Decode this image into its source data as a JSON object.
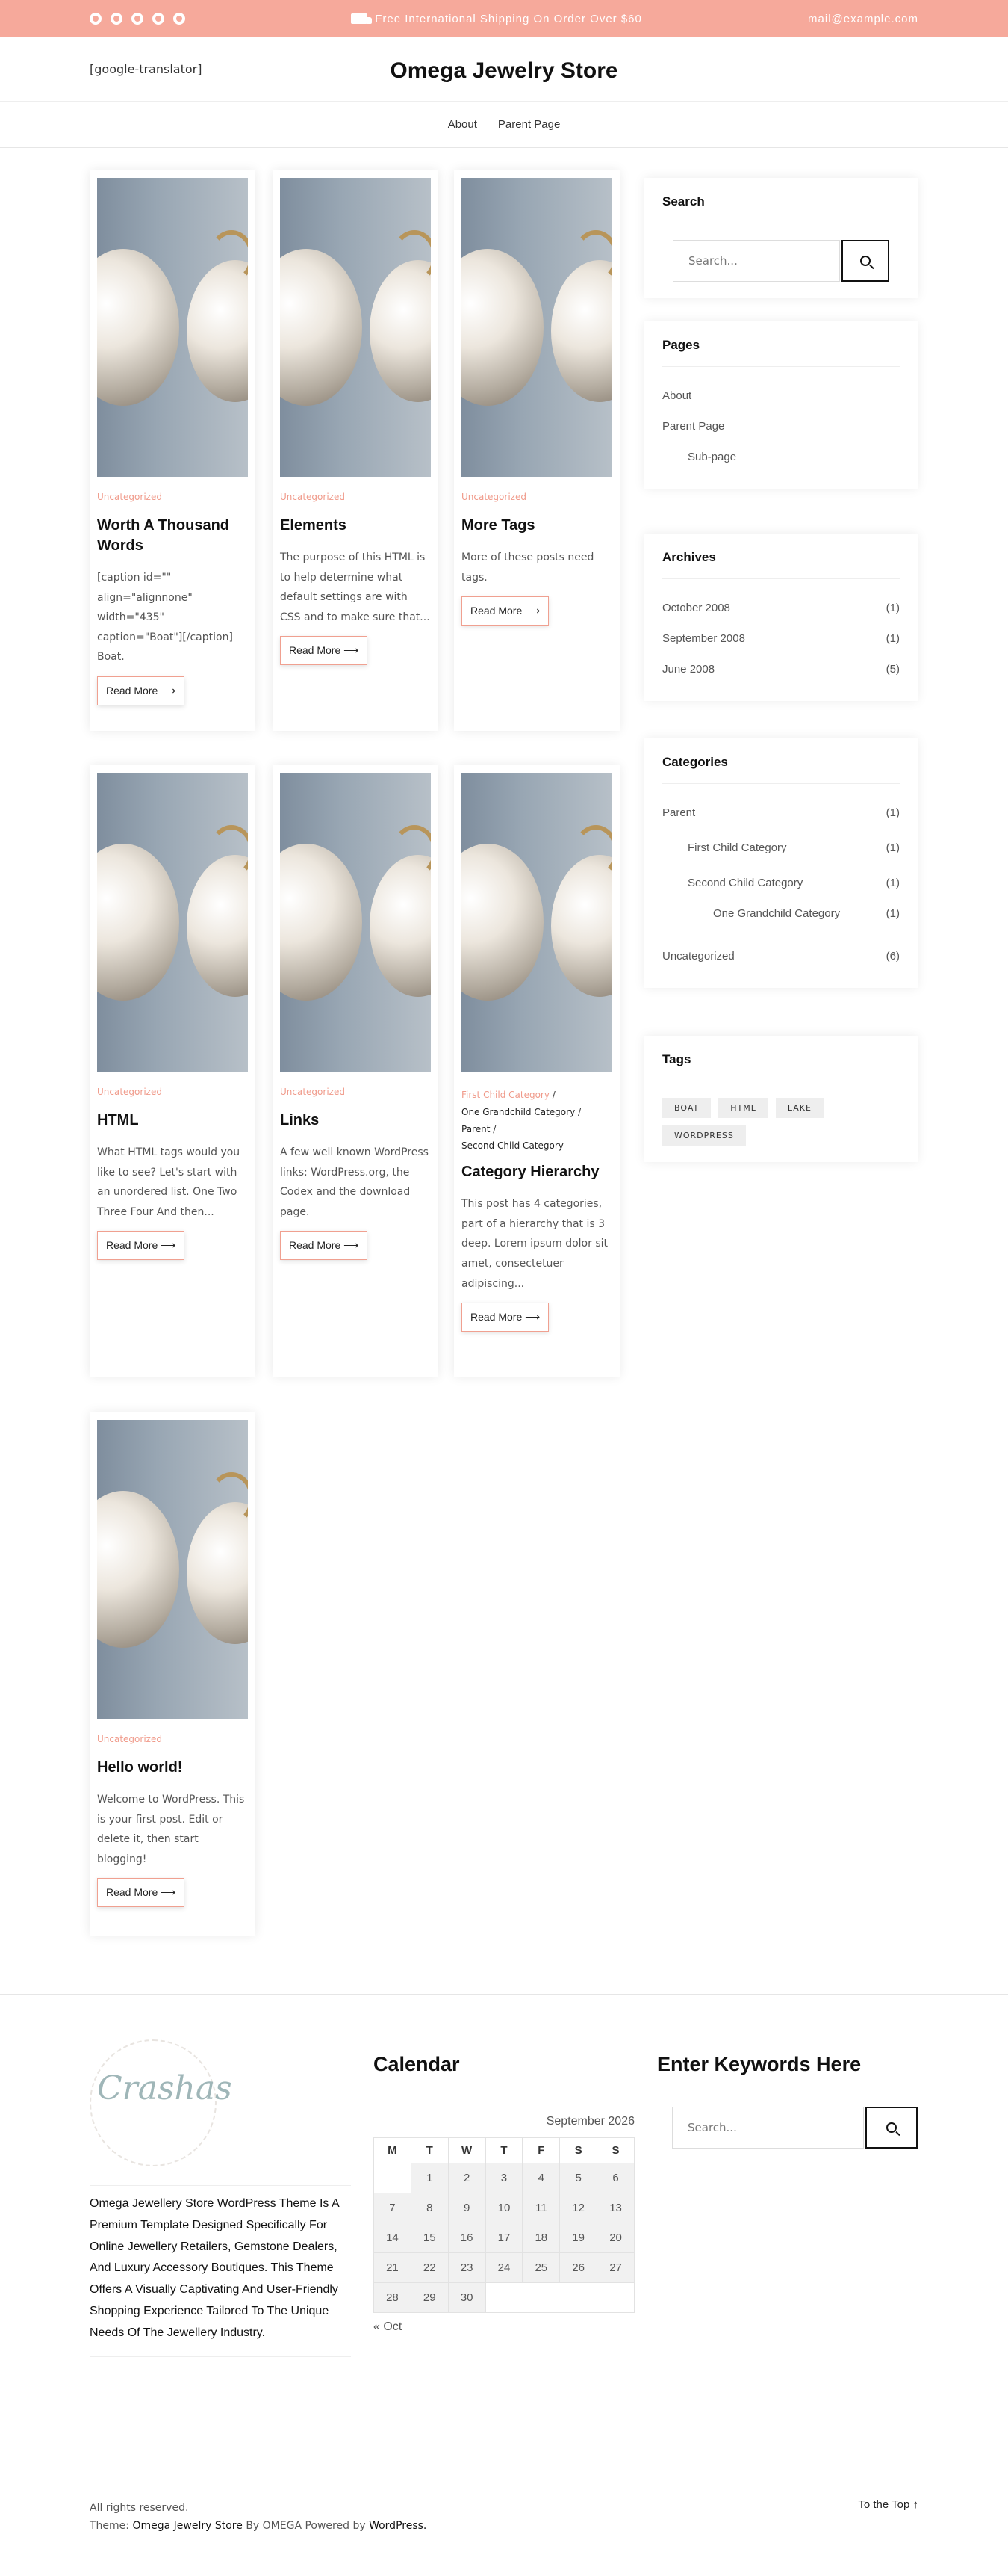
{
  "topbar": {
    "social_icons": [
      "facebook-icon",
      "twitter-icon",
      "pinterest-icon",
      "instagram-icon",
      "youtube-icon"
    ],
    "shipping_text": "Free International Shipping On Order Over $60",
    "email": "mail@example.com",
    "bg_color": "#f6a99b"
  },
  "header": {
    "translator": "[google-translator]",
    "site_title": "Omega Jewelry Store"
  },
  "nav": {
    "items": [
      "About",
      "Parent Page"
    ]
  },
  "posts": [
    {
      "category": "Uncategorized",
      "title": "Worth A Thousand Words",
      "excerpt": "[caption id=\"\" align=\"alignnone\" width=\"435\" caption=\"Boat\"][/caption] Boat.",
      "button": "Read More ⟶"
    },
    {
      "category": "Uncategorized",
      "title": "Elements",
      "excerpt": "The purpose of this HTML is to help determine what default settings are with CSS and to make sure that...",
      "button": "Read More ⟶"
    },
    {
      "category": "Uncategorized",
      "title": "More Tags",
      "excerpt": "More of these posts need tags.",
      "button": "Read More ⟶"
    },
    {
      "category": "Uncategorized",
      "title": "HTML",
      "excerpt": "What HTML tags would you like to see? Let's start with an unordered list. One Two Three Four And then...",
      "button": "Read More ⟶"
    },
    {
      "category": "Uncategorized",
      "title": "Links",
      "excerpt": "A few well known WordPress links: WordPress.org, the Codex and the download page.",
      "button": "Read More ⟶"
    },
    {
      "category_first": "First Child Category",
      "category_rest": [
        "One Grandchild Category",
        "Parent",
        "Second Child Category"
      ],
      "title": "Category Hierarchy",
      "excerpt": "This post has 4 categories, part of a hierarchy that is 3 deep. Lorem ipsum dolor sit amet, consectetuer adipiscing...",
      "button": "Read More ⟶"
    },
    {
      "category": "Uncategorized",
      "title": "Hello world!",
      "excerpt": "Welcome to WordPress. This is your first post. Edit or delete it, then start blogging!",
      "button": "Read More ⟶"
    }
  ],
  "sidebar": {
    "search": {
      "title": "Search",
      "placeholder": "Search..."
    },
    "pages": {
      "title": "Pages",
      "items": [
        "About",
        "Parent Page",
        "Sub-page"
      ]
    },
    "archives": {
      "title": "Archives",
      "items": [
        {
          "label": "October 2008",
          "count": "(1)"
        },
        {
          "label": "September 2008",
          "count": "(1)"
        },
        {
          "label": "June 2008",
          "count": "(5)"
        }
      ]
    },
    "categories": {
      "title": "Categories",
      "items": [
        {
          "label": "Parent",
          "count": "(1)"
        },
        {
          "label": "First Child Category",
          "count": "(1)"
        },
        {
          "label": "Second Child Category",
          "count": "(1)"
        },
        {
          "label": "One Grandchild Category",
          "count": "(1)"
        },
        {
          "label": "Uncategorized",
          "count": "(6)"
        }
      ]
    },
    "tags": {
      "title": "Tags",
      "items": [
        "BOAT",
        "HTML",
        "LAKE",
        "WORDPRESS"
      ]
    }
  },
  "footer": {
    "logo_text": "Crashas",
    "about": "Omega Jewellery Store WordPress Theme Is A Premium Template Designed Specifically For Online Jewellery Retailers, Gemstone Dealers, And Luxury Accessory Boutiques. This Theme Offers A Visually Captivating And User-Friendly Shopping Experience Tailored To The Unique Needs Of The Jewellery Industry.",
    "calendar": {
      "title": "Calendar",
      "caption": "September 2026",
      "headers": [
        "M",
        "T",
        "W",
        "T",
        "F",
        "S",
        "S"
      ],
      "rows": [
        [
          "",
          "1",
          "2",
          "3",
          "4",
          "5",
          "6"
        ],
        [
          "7",
          "8",
          "9",
          "10",
          "11",
          "12",
          "13"
        ],
        [
          "14",
          "15",
          "16",
          "17",
          "18",
          "19",
          "20"
        ],
        [
          "21",
          "22",
          "23",
          "24",
          "25",
          "26",
          "27"
        ],
        [
          "28",
          "29",
          "30",
          "",
          "",
          "",
          ""
        ]
      ],
      "prev": "« Oct"
    },
    "keywords": {
      "title": "Enter Keywords Here",
      "placeholder": "Search..."
    },
    "rights": "All rights reserved.",
    "theme_prefix": "Theme:",
    "theme_link": "Omega Jewelry Store",
    "by": "By OMEGA Powered by",
    "wp_link": "WordPress.",
    "to_top": "To the Top ↑"
  }
}
